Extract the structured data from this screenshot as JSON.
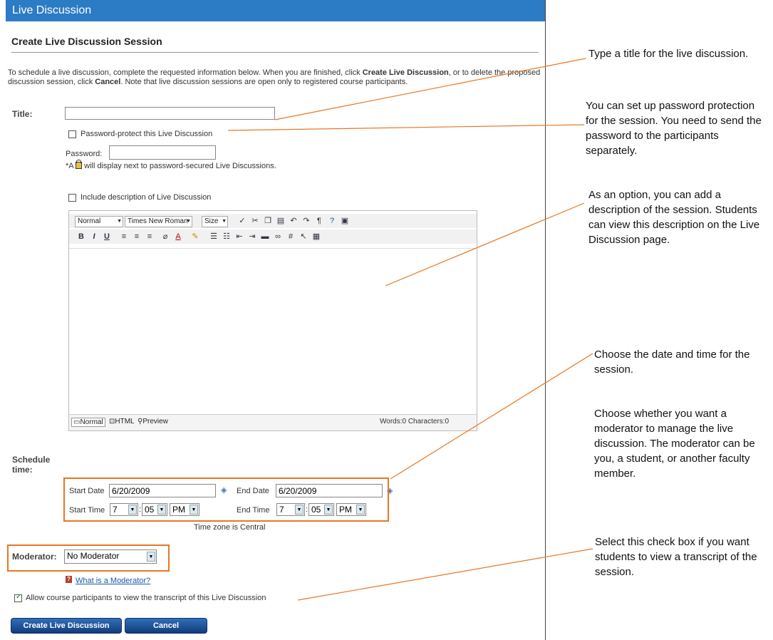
{
  "window": {
    "title": "Live Discussion"
  },
  "page": {
    "subtitle": "Create Live Discussion Session",
    "intro_1": "To schedule a live discussion, complete the requested information below. When you are finished, click ",
    "intro_b1": "Create Live Discussion",
    "intro_2": ", or to delete the proposed discussion session, click ",
    "intro_b2": "Cancel",
    "intro_3": ". Note that live discussion sessions are open only to registered course participants."
  },
  "form": {
    "title_label": "Title:",
    "title_value": "",
    "password_protect_label": "Password-protect this Live Discussion",
    "password_protect_checked": false,
    "password_label": "Password:",
    "password_value": "",
    "password_note_a": "*A",
    "password_note_b": "will display next to password-secured Live Discussions.",
    "include_desc_label": "Include description of Live Discussion",
    "include_desc_checked": false,
    "schedule_label_1": "Schedule",
    "schedule_label_2": "time:",
    "start_date_label": "Start Date",
    "start_date_value": "6/20/2009",
    "end_date_label": "End Date",
    "end_date_value": "6/20/2009",
    "start_time_label": "Start Time",
    "end_time_label": "End Time",
    "start_hour": "7",
    "start_minute": "05",
    "start_ampm": "PM",
    "end_hour": "7",
    "end_minute": "05",
    "end_ampm": "PM",
    "time_sep": ":",
    "timezone_note": "Time zone is Central",
    "moderator_label": "Moderator:",
    "moderator_value": "No Moderator",
    "moderator_help_link": "What is a Moderator?",
    "transcript_label": "Allow course participants to view the transcript of this Live Discussion",
    "transcript_checked": true
  },
  "editor": {
    "format_select": "Normal",
    "font_select": "Times New Roman",
    "size_select": "Size",
    "mode_normal": "Normal",
    "mode_html": "HTML",
    "mode_preview": "Preview",
    "word_count": "Words:0 Characters:0"
  },
  "buttons": {
    "create": "Create Live Discussion",
    "cancel": "Cancel"
  },
  "annotations": {
    "title_tip": "Type a title for the live discussion.",
    "password_tip": "You can set up password protection for the session. You need to send the password to the participants separately.",
    "description_tip": "As an option, you can add a description of the session. Students can view this description on the Live Discussion page.",
    "schedule_tip": "Choose the date and time for the session.",
    "moderator_tip": "Choose whether you want a moderator to manage the live discussion. The moderator can be you, a student, or another faculty member.",
    "transcript_tip": "Select this check box if you want students to view a transcript of the session."
  },
  "colors": {
    "titlebar": "#2c7bc5",
    "highlight": "#e87722",
    "button": "#1d4f96"
  }
}
